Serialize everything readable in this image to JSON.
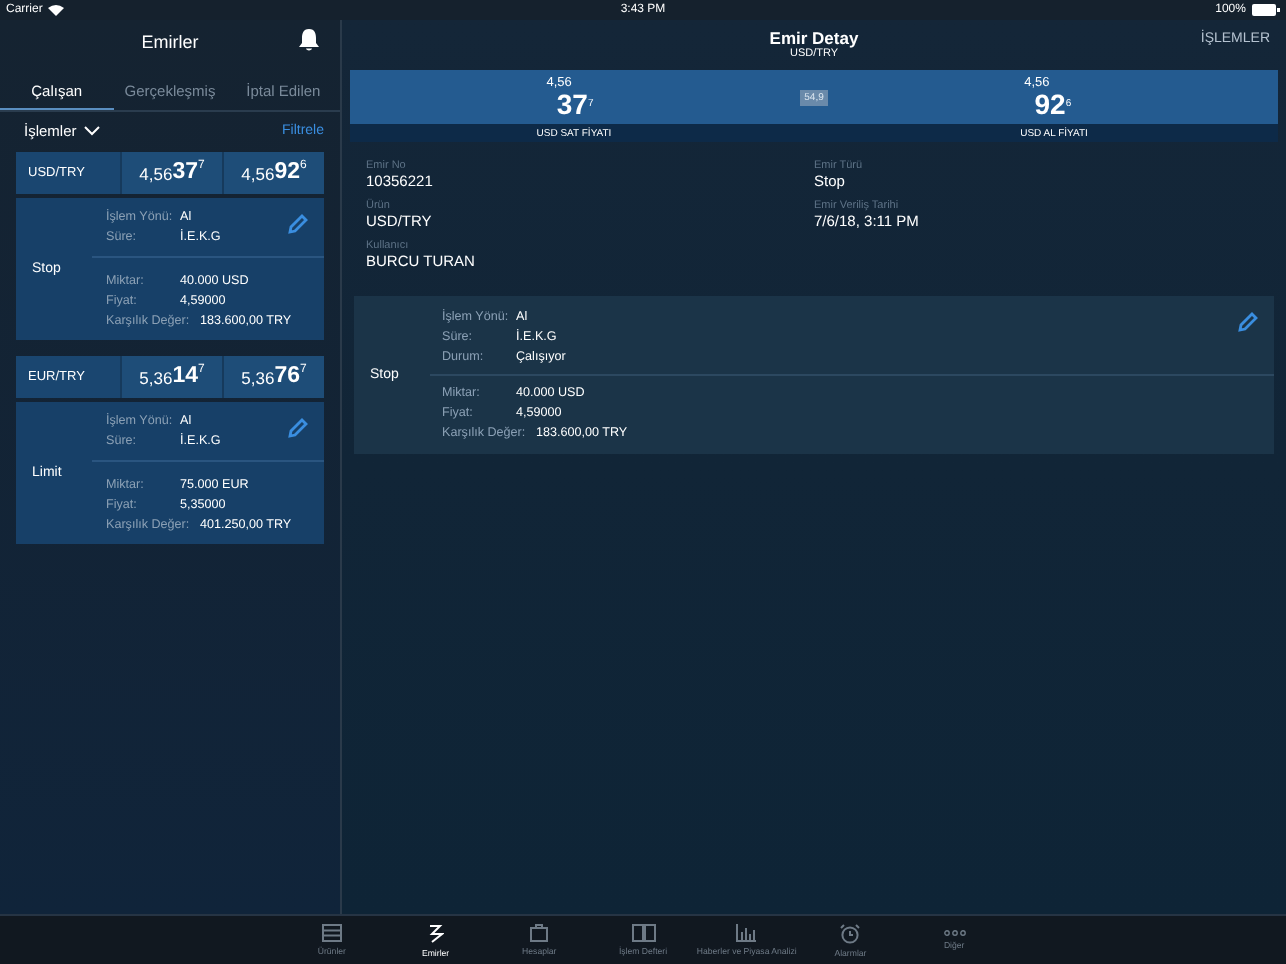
{
  "status_bar": {
    "carrier": "Carrier",
    "time": "3:43 PM",
    "battery": "100%"
  },
  "left": {
    "title": "Emirler",
    "tabs": [
      {
        "label": "Çalışan",
        "selected": true
      },
      {
        "label": "Gerçekleşmiş",
        "selected": false
      },
      {
        "label": "İptal Edilen",
        "selected": false
      }
    ],
    "filter": {
      "dropdown": "İşlemler",
      "action": "Filtrele"
    },
    "orders": [
      {
        "pair": "USD/TRY",
        "bid": {
          "prefix": "4,56",
          "big": "37",
          "pip": "7"
        },
        "ask": {
          "prefix": "4,56",
          "big": "92",
          "pip": "6"
        },
        "type": "Stop",
        "top": [
          {
            "label": "İşlem Yönü:",
            "value": "Al"
          },
          {
            "label": "Süre:",
            "value": "İ.E.K.G"
          }
        ],
        "bottom": [
          {
            "label": "Miktar:",
            "value": "40.000 USD"
          },
          {
            "label": "Fiyat:",
            "value": "4,59000"
          },
          {
            "label": "Karşılık Değer:",
            "value": "183.600,00 TRY"
          }
        ]
      },
      {
        "pair": "EUR/TRY",
        "bid": {
          "prefix": "5,36",
          "big": "14",
          "pip": "7"
        },
        "ask": {
          "prefix": "5,36",
          "big": "76",
          "pip": "7"
        },
        "type": "Limit",
        "top": [
          {
            "label": "İşlem Yönü:",
            "value": "Al"
          },
          {
            "label": "Süre:",
            "value": "İ.E.K.G"
          }
        ],
        "bottom": [
          {
            "label": "Miktar:",
            "value": "75.000 EUR"
          },
          {
            "label": "Fiyat:",
            "value": "5,35000"
          },
          {
            "label": "Karşılık Değer:",
            "value": "401.250,00 TRY"
          }
        ]
      }
    ]
  },
  "detail": {
    "title": "Emir Detay",
    "subtitle": "USD/TRY",
    "action": "İŞLEMLER",
    "quote": {
      "sell": {
        "prefix": "4,56",
        "big": "37",
        "pip": "7",
        "label": "USD SAT FİYATI"
      },
      "spread": "54,9",
      "buy": {
        "prefix": "4,56",
        "big": "92",
        "pip": "6",
        "label": "USD AL FİYATI"
      }
    },
    "fields": [
      {
        "label": "Emir No",
        "value": "10356221"
      },
      {
        "label": "Emir Türü",
        "value": "Stop"
      },
      {
        "label": "Ürün",
        "value": "USD/TRY"
      },
      {
        "label": "Emir Veriliş Tarihi",
        "value": "7/6/18, 3:11 PM"
      },
      {
        "label": "Kullanıcı",
        "value": "BURCU TURAN"
      }
    ],
    "card": {
      "type": "Stop",
      "top": [
        {
          "label": "İşlem Yönü:",
          "value": "Al"
        },
        {
          "label": "Süre:",
          "value": "İ.E.K.G"
        },
        {
          "label": "Durum:",
          "value": "Çalışıyor"
        }
      ],
      "bottom": [
        {
          "label": "Miktar:",
          "value": "40.000 USD"
        },
        {
          "label": "Fiyat:",
          "value": "4,59000"
        },
        {
          "label": "Karşılık Değer:",
          "value": "183.600,00 TRY"
        }
      ]
    }
  },
  "tab_bar": [
    {
      "label": "Ürünler",
      "kind": "list",
      "selected": false
    },
    {
      "label": "Emirler",
      "kind": "order",
      "selected": true
    },
    {
      "label": "Hesaplar",
      "kind": "case",
      "selected": false
    },
    {
      "label": "İşlem Defteri",
      "kind": "book",
      "selected": false
    },
    {
      "label": "Haberler ve Piyasa Analizi",
      "kind": "chart",
      "selected": false
    },
    {
      "label": "Alarmlar",
      "kind": "alarm",
      "selected": false
    },
    {
      "label": "Diğer",
      "kind": "more",
      "selected": false
    }
  ]
}
